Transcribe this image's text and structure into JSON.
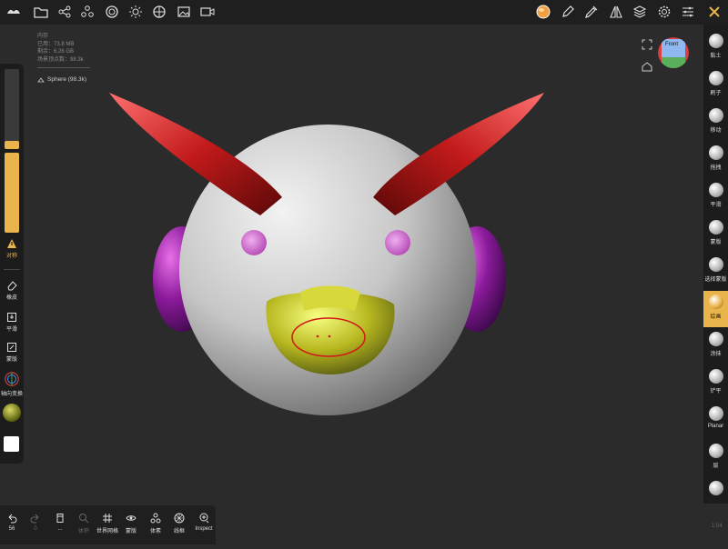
{
  "topbar": {
    "icons": [
      "menu-icon",
      "folder-icon",
      "share-icon",
      "scene-icon",
      "materials-icon",
      "light-icon",
      "postprocess-icon",
      "image-icon",
      "video-icon",
      "color-ball-icon",
      "pen-icon",
      "picker-icon",
      "symmetry-icon",
      "layers-icon",
      "settings-icon",
      "sliders-icon",
      "tools-icon"
    ]
  },
  "stats": {
    "title": "内存",
    "used": "已用：73.8 MB",
    "remaining": "剩余：6.26 GB",
    "vertices": "场景顶点数：98.3k"
  },
  "mesh": {
    "name": "Sphere (98.3k)"
  },
  "left_panel": {
    "radius_fraction": 0.1,
    "intensity_fraction": 1.0,
    "symmetry_label": "对称",
    "eraser_label": "橡皮",
    "smooth_label": "平滑",
    "mask_label": "蒙版",
    "axis_label": "轴向变换"
  },
  "right_tools": [
    {
      "label": "黏土",
      "active": false
    },
    {
      "label": "刷子",
      "active": false
    },
    {
      "label": "移动",
      "active": false
    },
    {
      "label": "拖拽",
      "active": false
    },
    {
      "label": "平滑",
      "active": false
    },
    {
      "label": "蒙版",
      "active": false
    },
    {
      "label": "选择蒙版",
      "active": false
    },
    {
      "label": "绘画",
      "active": true
    },
    {
      "label": "涂抹",
      "active": false
    },
    {
      "label": "铲平",
      "active": false
    },
    {
      "label": "Planar",
      "active": false
    },
    {
      "label": "层",
      "active": false
    },
    {
      "label": "",
      "active": false
    }
  ],
  "bottom_bar": {
    "undo_count": "56",
    "redo_count": "0",
    "more_label": "...",
    "search_label": "体积",
    "world_grid_label": "世界网格",
    "mask_label": "蒙版",
    "voxel_label": "体素",
    "wireframe_label": "线框",
    "inspect_label": "Inspect"
  },
  "gizmo": {
    "label": "Front"
  },
  "bottom_right_text": "1:04",
  "colors": {
    "accent": "#e9b44c",
    "panel": "#1c1c1c",
    "background": "#2b2b2b"
  }
}
